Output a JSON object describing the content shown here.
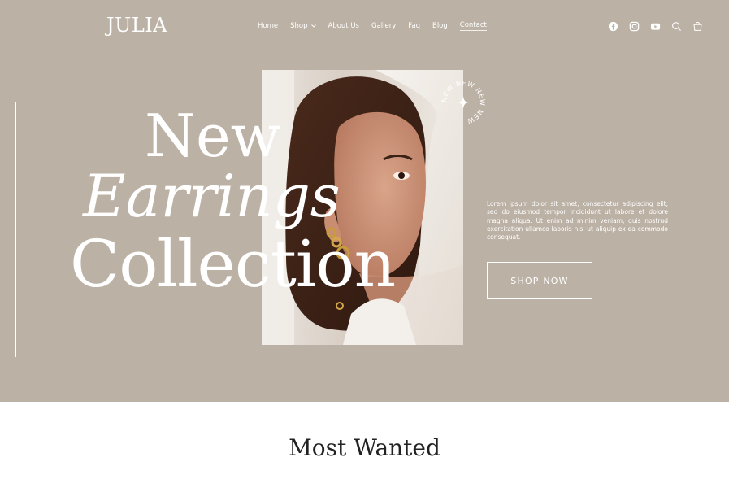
{
  "header": {
    "logo": "JULIA",
    "nav": [
      {
        "label": "Home"
      },
      {
        "label": "Shop",
        "has_dropdown": true
      },
      {
        "label": "About Us"
      },
      {
        "label": "Gallery"
      },
      {
        "label": "Faq"
      },
      {
        "label": "Blog"
      },
      {
        "label": "Contact"
      }
    ],
    "icons": [
      "facebook-icon",
      "instagram-icon",
      "youtube-icon",
      "search-icon",
      "cart-icon"
    ]
  },
  "hero": {
    "headline_line1": "New",
    "headline_line2": "Earrings",
    "headline_line3": "Collection",
    "badge_text": "NEW NEW NEW NEW",
    "description": "Lorem ipsum dolor sit amet, consectetur adipiscing elit, sed do eiusmod tempor incididunt ut labore et dolore magna aliqua. Ut enim ad minim veniam, quis nostrud exercitation ullamco laboris nisi ut aliquip ex ea commodo consequat.",
    "cta_label": "SHOP NOW",
    "bg_color": "#bcb1a5"
  },
  "section": {
    "title": "Most Wanted"
  }
}
